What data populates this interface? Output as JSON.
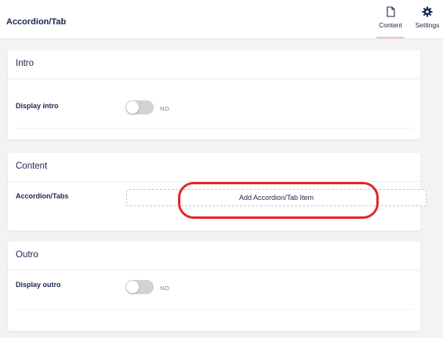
{
  "header": {
    "title": "Accordion/Tab",
    "tabs": [
      {
        "label": "Content",
        "icon": "document-icon",
        "active": true
      },
      {
        "label": "Settings",
        "icon": "gear-icon",
        "active": false
      }
    ],
    "active_underline_color": "#f5c1b4"
  },
  "sections": {
    "intro": {
      "title": "Intro",
      "field_label": "Display intro",
      "toggle_state": "NO"
    },
    "content": {
      "title": "Content",
      "field_label": "Accordion/Tabs",
      "add_button_label": "Add Accordion/Tab Item"
    },
    "outro": {
      "title": "Outro",
      "field_label": "Display outro",
      "toggle_state": "NO"
    }
  },
  "colors": {
    "text_primary": "#1b264f",
    "highlight": "#e3242b",
    "background": "#f3f3f5"
  }
}
